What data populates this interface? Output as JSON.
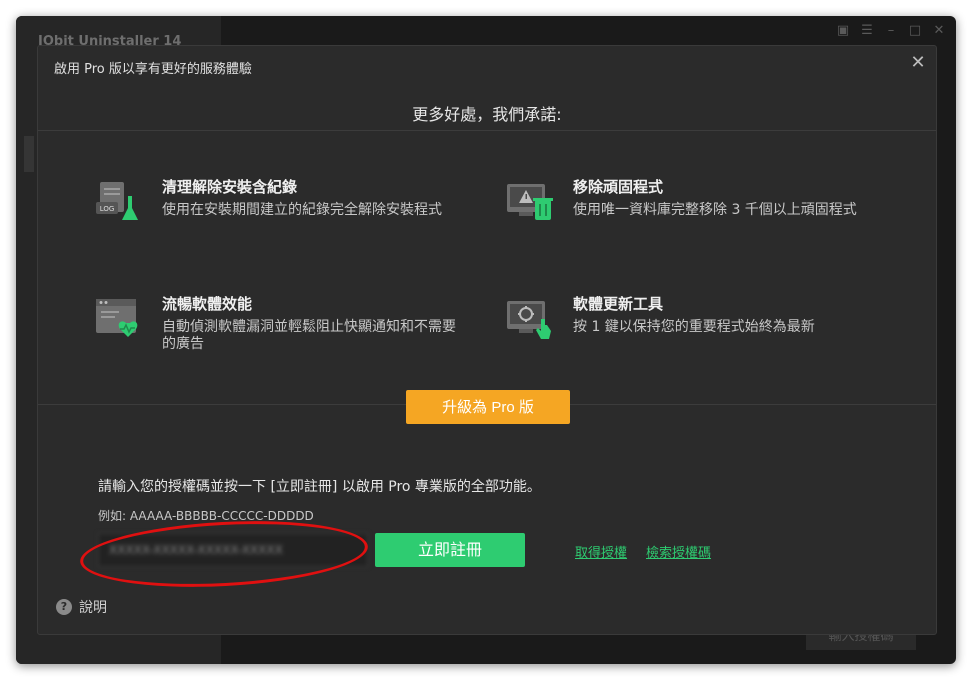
{
  "app": {
    "title": "IObit Uninstaller 14",
    "bottom_button": "輸入授權碼"
  },
  "dialog": {
    "title": "啟用 Pro 版以享有更好的服務體驗",
    "heading": "更多好處，我們承諾:",
    "features": [
      {
        "title": "清理解除安裝含紀錄",
        "desc": "使用在安裝期間建立的紀錄完全解除安裝程式",
        "icon": "log-cleanup-icon"
      },
      {
        "title": "移除頑固程式",
        "desc": "使用唯一資料庫完整移除 3 千個以上頑固程式",
        "icon": "stubborn-program-icon"
      },
      {
        "title": "流暢軟體效能",
        "desc": "自動偵測軟體漏洞並輕鬆阻止快顯通知和不需要的廣告",
        "icon": "performance-icon"
      },
      {
        "title": "軟體更新工具",
        "desc": "按 1 鍵以保持您的重要程式始終為最新",
        "icon": "software-update-icon"
      }
    ],
    "upgrade_label": "升級為 Pro 版",
    "register_prompt": "請輸入您的授權碼並按一下 [立即註冊] 以啟用 Pro 專業版的全部功能。",
    "example": "例如: AAAAA-BBBBB-CCCCC-DDDDD",
    "license_value": "XXXXX-XXXXX-XXXXX-XXXXX",
    "register_label": "立即註冊",
    "get_license_label": "取得授權",
    "retrieve_license_label": "檢索授權碼",
    "help_label": "說明"
  },
  "colors": {
    "accent_green": "#2ecc71",
    "accent_orange": "#f5a623",
    "annotation_red": "#e01010",
    "dialog_bg": "#2b2b2b"
  }
}
